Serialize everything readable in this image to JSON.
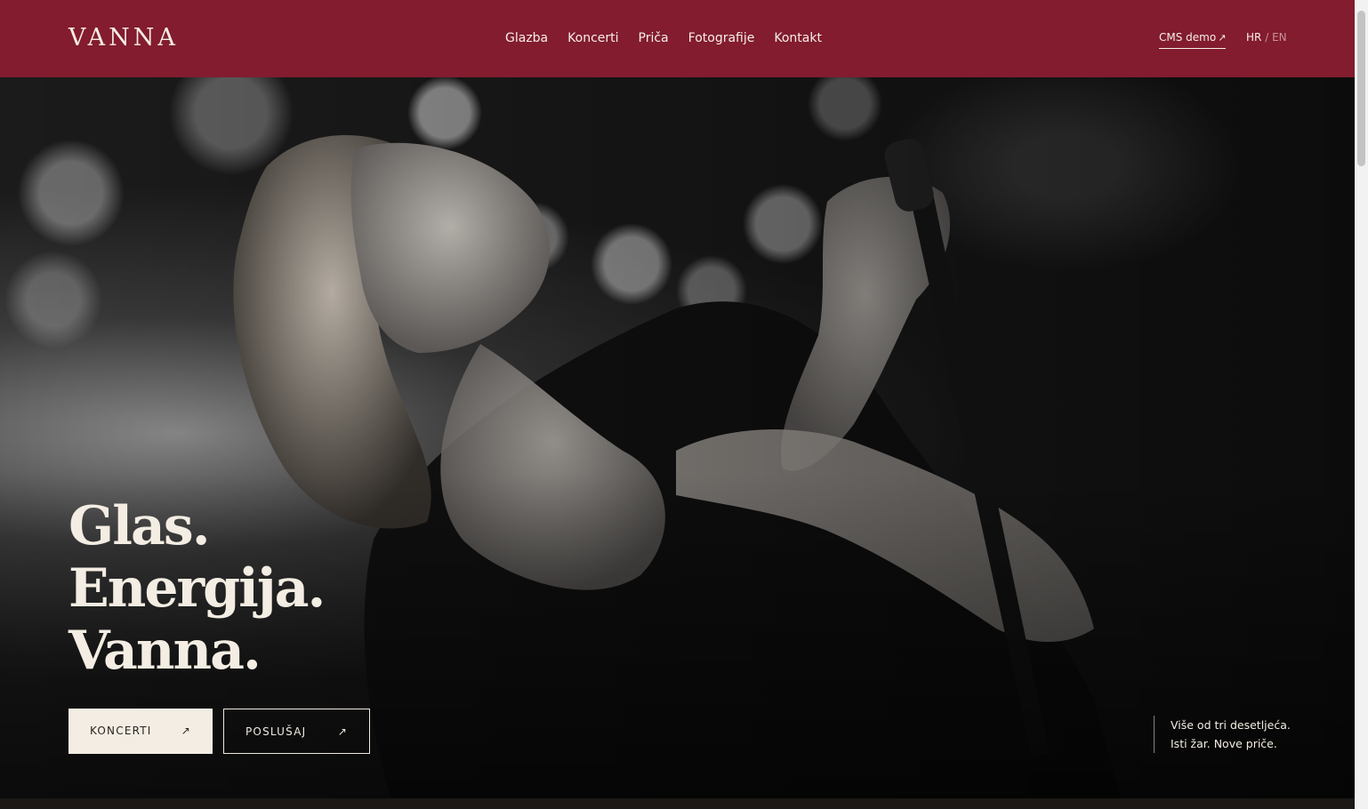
{
  "header": {
    "logo": "VANNA",
    "nav": [
      "Glazba",
      "Koncerti",
      "Priča",
      "Fotografije",
      "Kontakt"
    ],
    "cms_link": "CMS demo",
    "cms_arrow": "↗",
    "lang_active": "HR",
    "lang_separator": "/",
    "lang_inactive": "EN",
    "background_color": "#821c2e"
  },
  "hero": {
    "headline": [
      "Glas.",
      "Energija.",
      "Vanna."
    ],
    "buttons": [
      {
        "label": "KONCERTI",
        "arrow": "↗"
      },
      {
        "label": "POSLUŠAJ",
        "arrow": "↗"
      }
    ],
    "tagline": [
      "Više od tri desetljeća.",
      "Isti žar. Nove priče."
    ]
  },
  "colors": {
    "accent": "#821c2e",
    "cream": "#f3ede3",
    "dark": "#161413"
  }
}
